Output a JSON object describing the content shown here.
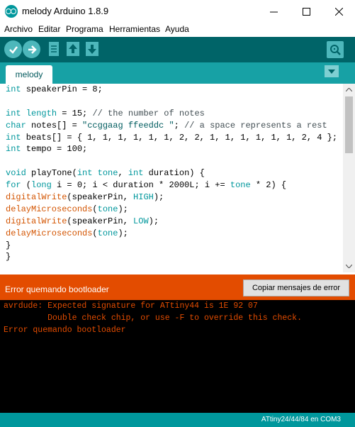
{
  "window": {
    "title": "melody Arduino 1.8.9",
    "minimize_icon": "minimize-icon",
    "maximize_icon": "maximize-icon",
    "close_icon": "close-icon"
  },
  "menu": {
    "items": [
      "Archivo",
      "Editar",
      "Programa",
      "Herramientas",
      "Ayuda"
    ]
  },
  "toolbar": {
    "icons": [
      "verify-icon",
      "upload-icon",
      "new-icon",
      "open-icon",
      "save-icon",
      "serial-monitor-icon"
    ]
  },
  "tabs": {
    "active": "melody",
    "menu_icon": "tab-menu-icon"
  },
  "editor": {
    "lines": [
      "int speakerPin = 8;",
      "",
      "int length = 15; // the number of notes",
      "char notes[] = \"ccggaag ffeeddc \"; // a space represents a rest",
      "int beats[] = { 1, 1, 1, 1, 1, 1, 2, 2, 1, 1, 1, 1, 1, 1, 2, 4 };",
      "int tempo = 100;",
      "",
      "void playTone(int tone, int duration) {",
      "for (long i = 0; i < duration * 2000L; i += tone * 2) {",
      "digitalWrite(speakerPin, HIGH);",
      "delayMicroseconds(tone);",
      "digitalWrite(speakerPin, LOW);",
      "delayMicroseconds(tone);",
      "}",
      "}"
    ]
  },
  "status": {
    "message": "Error quemando bootloader",
    "copy_button": "Copiar mensajes de error"
  },
  "console": {
    "lines": [
      "avrdude: Expected signature for ATtiny44 is 1E 92 07",
      "         Double check chip, or use -F to override this check.",
      "Error quemando bootloader"
    ]
  },
  "footer": {
    "board": "ATtiny24/44/84 en COM3"
  },
  "colors": {
    "teal_dark": "#006468",
    "teal": "#00979c",
    "tab_bar": "#17a1a5",
    "error_orange": "#e34c00"
  }
}
